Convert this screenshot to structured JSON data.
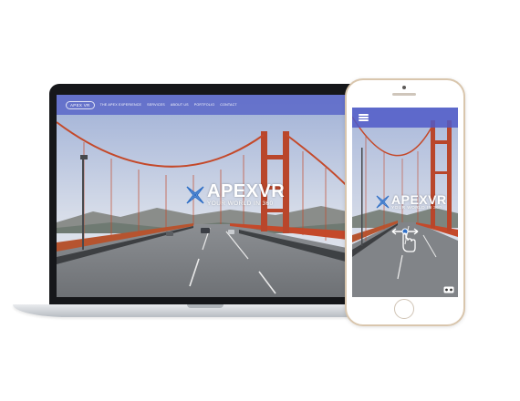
{
  "laptop": {
    "nav": {
      "logo": "APEX VR",
      "items": [
        "THE APEX EXPERIENCE",
        "SERVICES",
        "ABOUT US",
        "PORTFOLIO",
        "CONTACT"
      ]
    },
    "brand": {
      "name": "APEXVR",
      "tagline": "YOUR WORLD IN 360"
    }
  },
  "phone": {
    "brand": {
      "name": "APEXVR",
      "tagline": "YOUR WORLD IN 360"
    },
    "icons": [
      "menu-icon",
      "swipe-gesture-icon",
      "vr-headset-icon"
    ]
  },
  "colors": {
    "nav_bar": "#5864c8",
    "bridge": "#c4492a",
    "sky": "#c9d3e6",
    "logo_accent": "#2f6fc6"
  }
}
